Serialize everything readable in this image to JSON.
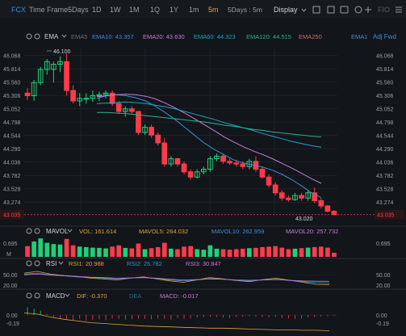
{
  "toolbar": {
    "symbol": "FCX",
    "items": [
      "Time Frame",
      "5Days",
      "1D",
      "1W",
      "1M",
      "1Q",
      "1Y",
      "1m",
      "5m"
    ],
    "active_item": "5m",
    "range": "5Days : 5m",
    "display": "Display",
    "right_label": "FIO",
    "icons": [
      "bar-chart-icon",
      "checkbox-icon",
      "calendar-icon",
      "camera-icon",
      "refresh-icon",
      "crosshair-icon",
      "menu-icon"
    ]
  },
  "ema_legend": {
    "title": "EMA",
    "items": [
      {
        "label": "EMA5",
        "value": "",
        "color": "#6b6f75"
      },
      {
        "label": "EMA10",
        "value": "43.357",
        "color": "#3d8fd6"
      },
      {
        "label": "EMA20",
        "value": "43.630",
        "color": "#c77cd6"
      },
      {
        "label": "EMA60",
        "value": "44.323",
        "color": "#1fa3c9"
      },
      {
        "label": "EMA120",
        "value": "44.515",
        "color": "#29b389"
      },
      {
        "label": "EMA250",
        "value": "",
        "color": "#d06a6a"
      },
      {
        "label": "EMA1",
        "value": "",
        "color": "#3d8fd6"
      }
    ],
    "adjust": "Adj Fwd"
  },
  "price_axis": {
    "ticks": [
      "46.068",
      "45.814",
      "45.560",
      "45.306",
      "45.052",
      "44.798",
      "44.544",
      "44.290",
      "44.036",
      "43.782",
      "43.528",
      "43.274"
    ],
    "last_price": "43.035",
    "high_label": "46.100",
    "low_label": "43.020"
  },
  "volume_legend": {
    "title": "MAVOL",
    "items": [
      {
        "label": "VOL",
        "value": "161.614",
        "color": "#e0a33a"
      },
      {
        "label": "MAVOL5",
        "value": "264.032",
        "color": "#e0a33a"
      },
      {
        "label": "MAVOL10",
        "value": "262.959",
        "color": "#3d8fd6"
      },
      {
        "label": "MAVOL20",
        "value": "257.732",
        "color": "#c77cd6"
      }
    ],
    "axis_top": "0.695",
    "axis_unit": "M"
  },
  "rsi_legend": {
    "title": "RSI",
    "items": [
      {
        "label": "RSI1",
        "value": "20.988",
        "color": "#e0a33a"
      },
      {
        "label": "RSI2",
        "value": "25.782",
        "color": "#3d8fd6"
      },
      {
        "label": "RSI3",
        "value": "30.847",
        "color": "#c77cd6"
      }
    ],
    "axis": [
      "50.00",
      "20.00"
    ]
  },
  "macd_legend": {
    "title": "MACD",
    "items": [
      {
        "label": "DIF",
        "value": "-0.370",
        "color": "#e0a33a"
      },
      {
        "label": "DEA",
        "value": "",
        "color": "#1f6f8b"
      },
      {
        "label": "MACD",
        "value": "-0.017",
        "color": "#c77cd6"
      }
    ],
    "axis": [
      "0.00",
      "-0.19"
    ]
  },
  "colors": {
    "up": "#1fcf7a",
    "down": "#ff3b4b",
    "bg": "#121519",
    "grid": "#2a2e34"
  },
  "chart_data": {
    "type": "candlestick",
    "ylim": [
      43.0,
      46.2
    ],
    "candles": [
      {
        "o": 45.35,
        "h": 45.45,
        "l": 45.22,
        "c": 45.3
      },
      {
        "o": 45.3,
        "h": 45.6,
        "l": 45.2,
        "c": 45.55
      },
      {
        "o": 45.55,
        "h": 45.85,
        "l": 45.5,
        "c": 45.8
      },
      {
        "o": 45.8,
        "h": 46.0,
        "l": 45.7,
        "c": 45.95
      },
      {
        "o": 45.8,
        "h": 45.95,
        "l": 45.55,
        "c": 45.9
      },
      {
        "o": 45.9,
        "h": 46.05,
        "l": 45.75,
        "c": 45.95
      },
      {
        "o": 45.95,
        "h": 46.1,
        "l": 45.3,
        "c": 45.4
      },
      {
        "o": 45.4,
        "h": 45.5,
        "l": 45.15,
        "c": 45.2
      },
      {
        "o": 45.2,
        "h": 45.35,
        "l": 45.1,
        "c": 45.25
      },
      {
        "o": 45.25,
        "h": 45.35,
        "l": 45.15,
        "c": 45.25
      },
      {
        "o": 45.25,
        "h": 45.4,
        "l": 45.18,
        "c": 45.3
      },
      {
        "o": 45.3,
        "h": 45.38,
        "l": 45.2,
        "c": 45.32
      },
      {
        "o": 45.32,
        "h": 45.4,
        "l": 45.25,
        "c": 45.35
      },
      {
        "o": 45.35,
        "h": 45.4,
        "l": 45.1,
        "c": 45.15
      },
      {
        "o": 45.15,
        "h": 45.2,
        "l": 44.95,
        "c": 45.0
      },
      {
        "o": 45.0,
        "h": 45.1,
        "l": 44.9,
        "c": 45.05
      },
      {
        "o": 45.05,
        "h": 45.1,
        "l": 44.95,
        "c": 45.0
      },
      {
        "o": 45.0,
        "h": 45.0,
        "l": 44.55,
        "c": 44.6
      },
      {
        "o": 44.6,
        "h": 44.75,
        "l": 44.55,
        "c": 44.7
      },
      {
        "o": 44.7,
        "h": 44.75,
        "l": 44.5,
        "c": 44.55
      },
      {
        "o": 44.55,
        "h": 44.6,
        "l": 44.35,
        "c": 44.4
      },
      {
        "o": 44.4,
        "h": 44.5,
        "l": 43.95,
        "c": 44.0
      },
      {
        "o": 44.0,
        "h": 44.15,
        "l": 43.95,
        "c": 44.1
      },
      {
        "o": 44.1,
        "h": 44.12,
        "l": 43.95,
        "c": 44.0
      },
      {
        "o": 44.0,
        "h": 44.05,
        "l": 43.8,
        "c": 43.85
      },
      {
        "o": 43.85,
        "h": 43.9,
        "l": 43.7,
        "c": 43.75
      },
      {
        "o": 43.75,
        "h": 43.9,
        "l": 43.72,
        "c": 43.85
      },
      {
        "o": 43.85,
        "h": 43.95,
        "l": 43.8,
        "c": 43.9
      },
      {
        "o": 43.9,
        "h": 44.15,
        "l": 43.85,
        "c": 44.1
      },
      {
        "o": 44.1,
        "h": 44.2,
        "l": 44.05,
        "c": 44.15
      },
      {
        "o": 44.15,
        "h": 44.2,
        "l": 44.0,
        "c": 44.05
      },
      {
        "o": 44.05,
        "h": 44.1,
        "l": 43.98,
        "c": 44.02
      },
      {
        "o": 44.02,
        "h": 44.08,
        "l": 43.95,
        "c": 44.0
      },
      {
        "o": 44.0,
        "h": 44.05,
        "l": 43.9,
        "c": 43.95
      },
      {
        "o": 43.95,
        "h": 44.1,
        "l": 43.9,
        "c": 44.05
      },
      {
        "o": 44.05,
        "h": 44.15,
        "l": 43.85,
        "c": 43.9
      },
      {
        "o": 43.9,
        "h": 43.95,
        "l": 43.72,
        "c": 43.75
      },
      {
        "o": 43.75,
        "h": 43.8,
        "l": 43.55,
        "c": 43.6
      },
      {
        "o": 43.6,
        "h": 43.65,
        "l": 43.4,
        "c": 43.45
      },
      {
        "o": 43.45,
        "h": 43.5,
        "l": 43.3,
        "c": 43.35
      },
      {
        "o": 43.35,
        "h": 43.4,
        "l": 43.28,
        "c": 43.32
      },
      {
        "o": 43.32,
        "h": 43.45,
        "l": 43.3,
        "c": 43.4
      },
      {
        "o": 43.4,
        "h": 43.45,
        "l": 43.3,
        "c": 43.35
      },
      {
        "o": 43.35,
        "h": 43.5,
        "l": 43.3,
        "c": 43.45
      },
      {
        "o": 43.45,
        "h": 43.55,
        "l": 43.25,
        "c": 43.3
      },
      {
        "o": 43.3,
        "h": 43.35,
        "l": 43.15,
        "c": 43.2
      },
      {
        "o": 43.2,
        "h": 43.22,
        "l": 43.08,
        "c": 43.1
      },
      {
        "o": 43.1,
        "h": 43.12,
        "l": 43.02,
        "c": 43.035
      }
    ],
    "ema_lines": [
      {
        "name": "EMA10",
        "color": "#3d8fd6",
        "values": [
          45.25,
          45.3,
          45.32,
          45.3,
          45.26,
          45.2,
          45.1,
          44.98,
          44.85,
          44.7,
          44.55,
          44.4,
          44.28,
          44.18,
          44.08,
          44.02,
          43.98,
          43.94,
          43.88,
          43.8,
          43.7,
          43.58,
          43.45,
          43.36
        ]
      },
      {
        "name": "EMA20",
        "color": "#c77cd6",
        "values": [
          45.28,
          45.3,
          45.32,
          45.33,
          45.32,
          45.29,
          45.24,
          45.16,
          45.07,
          44.97,
          44.86,
          44.75,
          44.64,
          44.52,
          44.42,
          44.33,
          44.25,
          44.18,
          44.1,
          44.01,
          43.92,
          43.82,
          43.72,
          43.63
        ]
      },
      {
        "name": "EMA60",
        "color": "#1fa3c9",
        "values": [
          45.15,
          45.16,
          45.17,
          45.18,
          45.17,
          45.15,
          45.12,
          45.09,
          45.05,
          45.0,
          44.95,
          44.9,
          44.85,
          44.79,
          44.74,
          44.69,
          44.64,
          44.58,
          44.53,
          44.48,
          44.43,
          44.39,
          44.35,
          44.32
        ]
      },
      {
        "name": "EMA120",
        "color": "#29b389",
        "values": [
          44.98,
          44.98,
          44.97,
          44.96,
          44.94,
          44.92,
          44.9,
          44.88,
          44.86,
          44.84,
          44.82,
          44.8,
          44.77,
          44.74,
          44.72,
          44.69,
          44.66,
          44.64,
          44.61,
          44.59,
          44.57,
          44.55,
          44.53,
          44.515
        ]
      }
    ],
    "volume": [
      0.42,
      0.6,
      0.72,
      0.55,
      0.5,
      0.48,
      0.7,
      0.45,
      0.4,
      0.38,
      0.36,
      0.35,
      0.33,
      0.4,
      0.45,
      0.35,
      0.33,
      0.52,
      0.3,
      0.34,
      0.38,
      0.55,
      0.32,
      0.3,
      0.4,
      0.42,
      0.3,
      0.28,
      0.45,
      0.32,
      0.3,
      0.28,
      0.3,
      0.32,
      0.34,
      0.35,
      0.38,
      0.4,
      0.42,
      0.36,
      0.3,
      0.32,
      0.34,
      0.36,
      0.38,
      0.4,
      0.36,
      0.16
    ],
    "volume_max": 0.695,
    "rsi_lines": [
      {
        "name": "RSI1",
        "color": "#e0a33a",
        "values": [
          55,
          60,
          52,
          48,
          45,
          40,
          38,
          35,
          40,
          44,
          38,
          32,
          28,
          35,
          42,
          38,
          33,
          30,
          36,
          40,
          34,
          28,
          22,
          21
        ]
      },
      {
        "name": "RSI2",
        "color": "#3d8fd6",
        "values": [
          52,
          55,
          50,
          47,
          44,
          42,
          40,
          38,
          40,
          42,
          39,
          35,
          32,
          35,
          39,
          37,
          34,
          32,
          35,
          37,
          33,
          30,
          27,
          25.8
        ]
      },
      {
        "name": "RSI3",
        "color": "#c77cd6",
        "values": [
          50,
          52,
          49,
          47,
          45,
          43,
          42,
          40,
          41,
          42,
          40,
          37,
          35,
          36,
          38,
          37,
          35,
          34,
          35,
          36,
          34,
          32,
          31,
          30.8
        ]
      }
    ],
    "macd": [
      0.18,
      0.15,
      0.1,
      0.02,
      -0.05,
      -0.08,
      -0.1,
      -0.12,
      -0.09,
      -0.13,
      -0.11,
      -0.1,
      -0.12,
      -0.08,
      -0.09,
      -0.11,
      -0.1,
      -0.08,
      -0.09,
      -0.1,
      -0.08,
      -0.09,
      -0.11,
      -0.07,
      -0.09,
      -0.08,
      -0.06,
      -0.05,
      -0.04,
      -0.05,
      -0.06,
      -0.07,
      -0.05,
      -0.04,
      -0.03,
      -0.04,
      -0.05,
      -0.06,
      -0.05,
      -0.07,
      -0.08,
      -0.09,
      -0.08,
      -0.06,
      -0.05,
      -0.04,
      -0.03,
      -0.02
    ],
    "dif_line": [
      0.05,
      0.02,
      -0.05,
      -0.1,
      -0.14,
      -0.18,
      -0.2,
      -0.22,
      -0.24,
      -0.26,
      -0.27,
      -0.28,
      -0.29,
      -0.3,
      -0.31,
      -0.31,
      -0.32,
      -0.33,
      -0.34,
      -0.35,
      -0.35,
      -0.36,
      -0.36,
      -0.37
    ]
  }
}
